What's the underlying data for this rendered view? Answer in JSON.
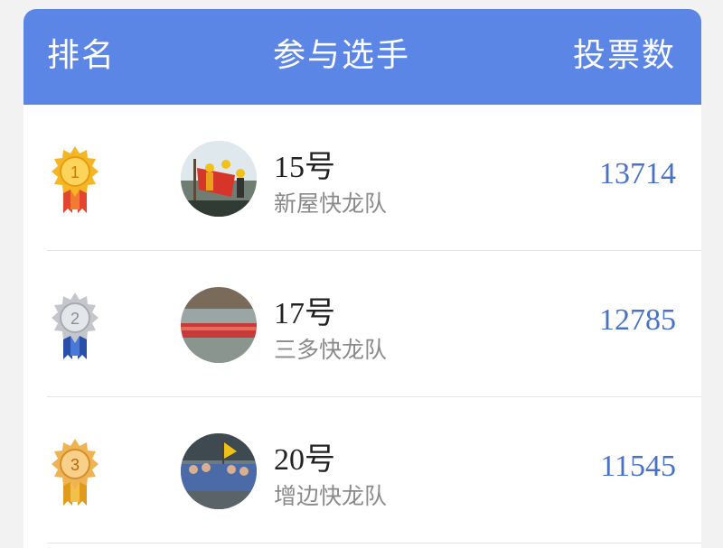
{
  "header": {
    "rank_label": "排名",
    "player_label": "参与选手",
    "votes_label": "投票数",
    "background_color": "#5b86e5"
  },
  "rows": [
    {
      "rank": "1",
      "medal": "gold",
      "number": "15号",
      "team": "新屋快龙队",
      "votes": "13714"
    },
    {
      "rank": "2",
      "medal": "silver",
      "number": "17号",
      "team": "三多快龙队",
      "votes": "12785"
    },
    {
      "rank": "3",
      "medal": "bronze",
      "number": "20号",
      "team": "增边快龙队",
      "votes": "11545"
    }
  ],
  "colors": {
    "votes_text": "#4a72c4",
    "gold": "#f4b623",
    "silver": "#c3c6cc",
    "bronze": "#f0b353"
  }
}
